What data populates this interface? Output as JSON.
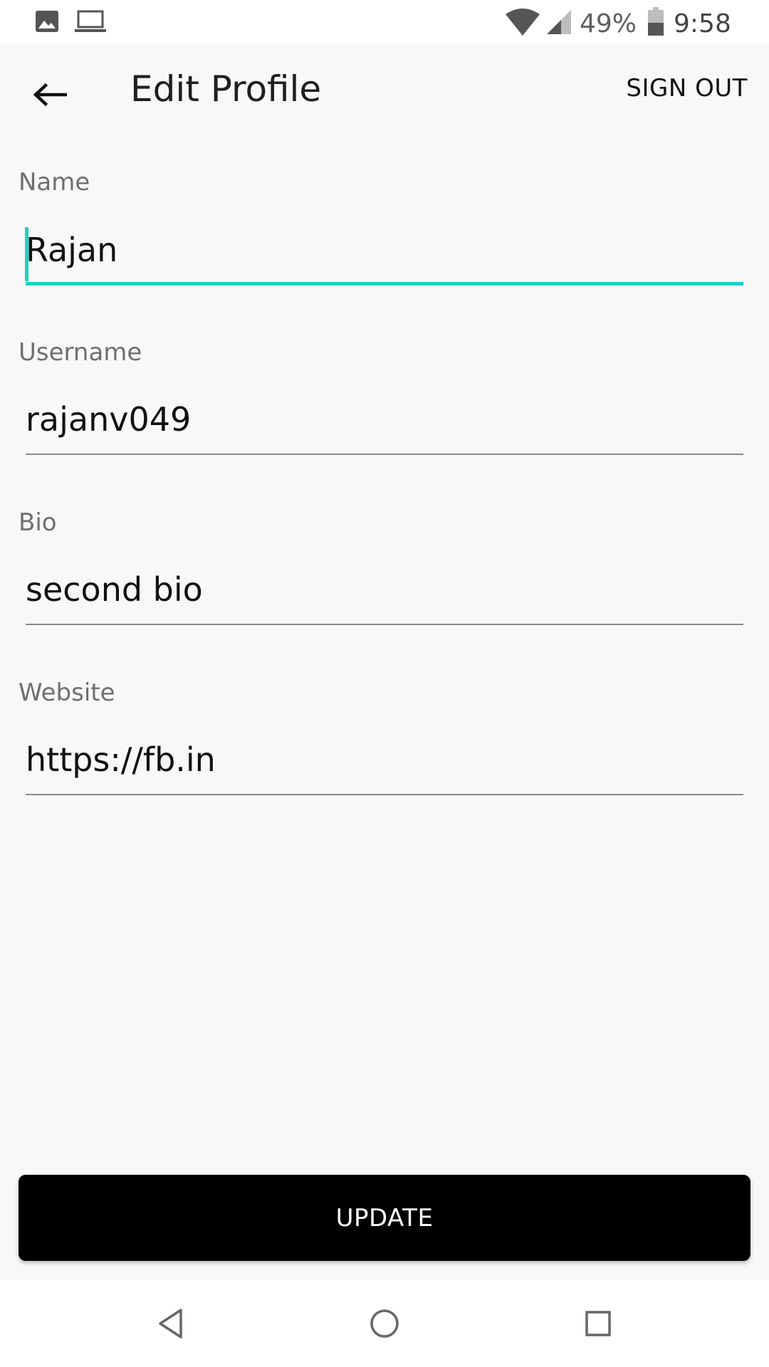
{
  "status_bar": {
    "left_icons": [
      "image-icon",
      "laptop-icon"
    ],
    "right_icons": [
      "wifi-icon",
      "cellular-signal-icon",
      "battery-icon"
    ],
    "battery_percent": "49%",
    "time": "9:58"
  },
  "app_bar": {
    "back_icon": "arrow-back-icon",
    "title": "Edit Profile",
    "sign_out_label": "SIGN OUT"
  },
  "form": {
    "name": {
      "label": "Name",
      "value": "Rajan",
      "focused": true
    },
    "username": {
      "label": "Username",
      "value": "rajanv049"
    },
    "bio": {
      "label": "Bio",
      "value": "second bio"
    },
    "website": {
      "label": "Website",
      "value": "https://fb.in"
    }
  },
  "update_button": {
    "label": "UPDATE"
  },
  "nav_bar": {
    "icons": [
      "nav-back-icon",
      "nav-home-icon",
      "nav-recents-icon"
    ]
  },
  "colors": {
    "accent": "#1cd2c0",
    "background": "#f8f8f8",
    "button_bg": "#000000",
    "text_primary": "#111111",
    "text_label": "#6f6f6f"
  }
}
